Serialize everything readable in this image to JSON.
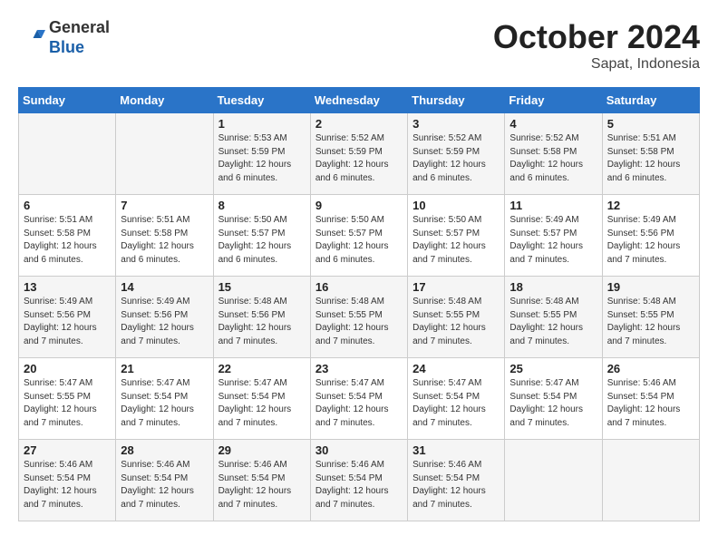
{
  "header": {
    "logo_general": "General",
    "logo_blue": "Blue",
    "month": "October 2024",
    "location": "Sapat, Indonesia"
  },
  "days_of_week": [
    "Sunday",
    "Monday",
    "Tuesday",
    "Wednesday",
    "Thursday",
    "Friday",
    "Saturday"
  ],
  "weeks": [
    [
      null,
      null,
      {
        "day": "1",
        "sunrise": "Sunrise: 5:53 AM",
        "sunset": "Sunset: 5:59 PM",
        "daylight": "Daylight: 12 hours and 6 minutes."
      },
      {
        "day": "2",
        "sunrise": "Sunrise: 5:52 AM",
        "sunset": "Sunset: 5:59 PM",
        "daylight": "Daylight: 12 hours and 6 minutes."
      },
      {
        "day": "3",
        "sunrise": "Sunrise: 5:52 AM",
        "sunset": "Sunset: 5:59 PM",
        "daylight": "Daylight: 12 hours and 6 minutes."
      },
      {
        "day": "4",
        "sunrise": "Sunrise: 5:52 AM",
        "sunset": "Sunset: 5:58 PM",
        "daylight": "Daylight: 12 hours and 6 minutes."
      },
      {
        "day": "5",
        "sunrise": "Sunrise: 5:51 AM",
        "sunset": "Sunset: 5:58 PM",
        "daylight": "Daylight: 12 hours and 6 minutes."
      }
    ],
    [
      {
        "day": "6",
        "sunrise": "Sunrise: 5:51 AM",
        "sunset": "Sunset: 5:58 PM",
        "daylight": "Daylight: 12 hours and 6 minutes."
      },
      {
        "day": "7",
        "sunrise": "Sunrise: 5:51 AM",
        "sunset": "Sunset: 5:58 PM",
        "daylight": "Daylight: 12 hours and 6 minutes."
      },
      {
        "day": "8",
        "sunrise": "Sunrise: 5:50 AM",
        "sunset": "Sunset: 5:57 PM",
        "daylight": "Daylight: 12 hours and 6 minutes."
      },
      {
        "day": "9",
        "sunrise": "Sunrise: 5:50 AM",
        "sunset": "Sunset: 5:57 PM",
        "daylight": "Daylight: 12 hours and 6 minutes."
      },
      {
        "day": "10",
        "sunrise": "Sunrise: 5:50 AM",
        "sunset": "Sunset: 5:57 PM",
        "daylight": "Daylight: 12 hours and 7 minutes."
      },
      {
        "day": "11",
        "sunrise": "Sunrise: 5:49 AM",
        "sunset": "Sunset: 5:57 PM",
        "daylight": "Daylight: 12 hours and 7 minutes."
      },
      {
        "day": "12",
        "sunrise": "Sunrise: 5:49 AM",
        "sunset": "Sunset: 5:56 PM",
        "daylight": "Daylight: 12 hours and 7 minutes."
      }
    ],
    [
      {
        "day": "13",
        "sunrise": "Sunrise: 5:49 AM",
        "sunset": "Sunset: 5:56 PM",
        "daylight": "Daylight: 12 hours and 7 minutes."
      },
      {
        "day": "14",
        "sunrise": "Sunrise: 5:49 AM",
        "sunset": "Sunset: 5:56 PM",
        "daylight": "Daylight: 12 hours and 7 minutes."
      },
      {
        "day": "15",
        "sunrise": "Sunrise: 5:48 AM",
        "sunset": "Sunset: 5:56 PM",
        "daylight": "Daylight: 12 hours and 7 minutes."
      },
      {
        "day": "16",
        "sunrise": "Sunrise: 5:48 AM",
        "sunset": "Sunset: 5:55 PM",
        "daylight": "Daylight: 12 hours and 7 minutes."
      },
      {
        "day": "17",
        "sunrise": "Sunrise: 5:48 AM",
        "sunset": "Sunset: 5:55 PM",
        "daylight": "Daylight: 12 hours and 7 minutes."
      },
      {
        "day": "18",
        "sunrise": "Sunrise: 5:48 AM",
        "sunset": "Sunset: 5:55 PM",
        "daylight": "Daylight: 12 hours and 7 minutes."
      },
      {
        "day": "19",
        "sunrise": "Sunrise: 5:48 AM",
        "sunset": "Sunset: 5:55 PM",
        "daylight": "Daylight: 12 hours and 7 minutes."
      }
    ],
    [
      {
        "day": "20",
        "sunrise": "Sunrise: 5:47 AM",
        "sunset": "Sunset: 5:55 PM",
        "daylight": "Daylight: 12 hours and 7 minutes."
      },
      {
        "day": "21",
        "sunrise": "Sunrise: 5:47 AM",
        "sunset": "Sunset: 5:54 PM",
        "daylight": "Daylight: 12 hours and 7 minutes."
      },
      {
        "day": "22",
        "sunrise": "Sunrise: 5:47 AM",
        "sunset": "Sunset: 5:54 PM",
        "daylight": "Daylight: 12 hours and 7 minutes."
      },
      {
        "day": "23",
        "sunrise": "Sunrise: 5:47 AM",
        "sunset": "Sunset: 5:54 PM",
        "daylight": "Daylight: 12 hours and 7 minutes."
      },
      {
        "day": "24",
        "sunrise": "Sunrise: 5:47 AM",
        "sunset": "Sunset: 5:54 PM",
        "daylight": "Daylight: 12 hours and 7 minutes."
      },
      {
        "day": "25",
        "sunrise": "Sunrise: 5:47 AM",
        "sunset": "Sunset: 5:54 PM",
        "daylight": "Daylight: 12 hours and 7 minutes."
      },
      {
        "day": "26",
        "sunrise": "Sunrise: 5:46 AM",
        "sunset": "Sunset: 5:54 PM",
        "daylight": "Daylight: 12 hours and 7 minutes."
      }
    ],
    [
      {
        "day": "27",
        "sunrise": "Sunrise: 5:46 AM",
        "sunset": "Sunset: 5:54 PM",
        "daylight": "Daylight: 12 hours and 7 minutes."
      },
      {
        "day": "28",
        "sunrise": "Sunrise: 5:46 AM",
        "sunset": "Sunset: 5:54 PM",
        "daylight": "Daylight: 12 hours and 7 minutes."
      },
      {
        "day": "29",
        "sunrise": "Sunrise: 5:46 AM",
        "sunset": "Sunset: 5:54 PM",
        "daylight": "Daylight: 12 hours and 7 minutes."
      },
      {
        "day": "30",
        "sunrise": "Sunrise: 5:46 AM",
        "sunset": "Sunset: 5:54 PM",
        "daylight": "Daylight: 12 hours and 7 minutes."
      },
      {
        "day": "31",
        "sunrise": "Sunrise: 5:46 AM",
        "sunset": "Sunset: 5:54 PM",
        "daylight": "Daylight: 12 hours and 7 minutes."
      },
      null,
      null
    ]
  ]
}
